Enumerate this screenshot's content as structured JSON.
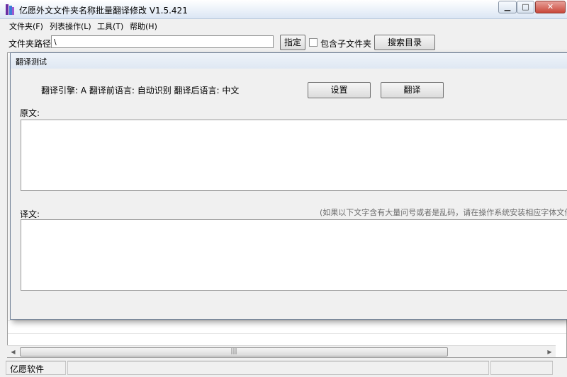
{
  "window": {
    "title": "亿愿外文文件夹名称批量翻译修改 V1.5.421",
    "min_glyph": "▁",
    "max_glyph": "□",
    "close_glyph": "✕"
  },
  "menu": [
    {
      "label": "文件夹(F)"
    },
    {
      "label": "列表操作(L)"
    },
    {
      "label": "工具(T)"
    },
    {
      "label": "帮助(H)"
    }
  ],
  "toolbar": {
    "path_label": "文件夹路径:",
    "path_value": "\\",
    "assign_label": "指定",
    "include_sub_label": "包含子文件夹",
    "include_sub_checked": false,
    "search_label": "搜索目录"
  },
  "list": {
    "scroll_thumb_glyph": "|||",
    "scroll_left_glyph": "◀",
    "scroll_right_glyph": "▶"
  },
  "statusbar": {
    "app_name": "亿愿软件"
  },
  "dialog": {
    "title": "翻译测试",
    "engine_info": "翻译引擎: A 翻译前语言: 自动识别 翻译后语言: 中文",
    "settings_label": "设置",
    "translate_label": "翻译",
    "source_label": "原文:",
    "source_text": "",
    "target_label": "译文:",
    "target_hint": "(如果以下文字含有大量问号或者是乱码，请在操作系统安装相应字体文件)",
    "target_text": ""
  },
  "icons": {
    "app_icon": "purple-book-icon",
    "colors": {
      "app_icon_primary": "#6b2fa3",
      "app_icon_secondary": "#3b7bd8"
    }
  }
}
